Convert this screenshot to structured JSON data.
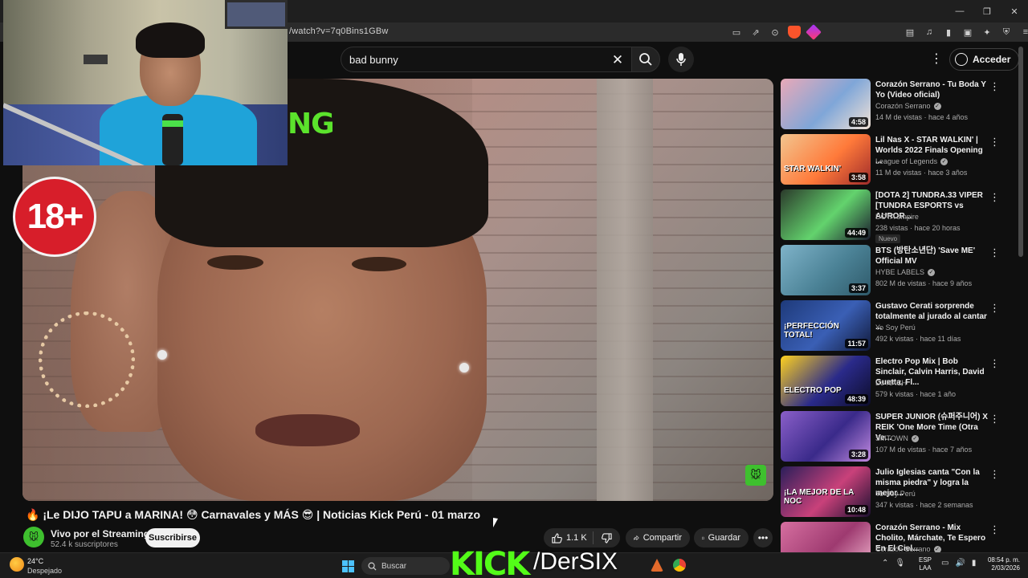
{
  "browser": {
    "url": "/watch?v=7q0Bins1GBw"
  },
  "youtube": {
    "search_query": "bad bunny",
    "signin_label": "Acceder"
  },
  "video": {
    "badge": "18+",
    "overlay_text": "NG",
    "title": "🔥 ¡Le DIJO TAPU a MARINA! 😳 Carnavales y MÁS 😎 | Noticias Kick Perú - 01 marzo",
    "channel": "Vivo por el Streaming",
    "subscribers": "52.4 k suscriptores",
    "subscribe_label": "Suscribirse",
    "likes": "1.1 K",
    "share_label": "Compartir",
    "save_label": "Guardar"
  },
  "recommendations": [
    {
      "title": "Corazón Serrano - Tu Boda Y Yo (Video oficial)",
      "channel": "Corazón Serrano",
      "verified": true,
      "meta": "14 M de vistas · hace 4 años",
      "duration": "4:58",
      "colors": [
        "#e9a9b8",
        "#7fa6d8",
        "#f2e2d6"
      ]
    },
    {
      "title": "Lil Nas X - STAR WALKIN' | Worlds 2022 Finals Opening ...",
      "channel": "League of Legends",
      "verified": true,
      "meta": "11 M de vistas · hace 3 años",
      "duration": "3:58",
      "thumb_text": "STAR WALKIN'",
      "colors": [
        "#f2c58f",
        "#ff7a3a",
        "#9e2b2b"
      ]
    },
    {
      "title": "[DOTA 2] TUNDRA.33 VIPER [TUNDRA ESPORTS vs AUROR...",
      "channel": "DOTA empire",
      "verified": false,
      "meta": "238 vistas · hace 20 horas",
      "duration": "44:49",
      "badge": "Nuevo",
      "colors": [
        "#2b3a2b",
        "#63d36d",
        "#1b1b2e"
      ]
    },
    {
      "title": "BTS (방탄소년단) 'Save ME' Official MV",
      "channel": "HYBE LABELS",
      "verified": true,
      "meta": "802 M de vistas · hace 9 años",
      "duration": "3:37",
      "colors": [
        "#7fb3c9",
        "#4b8296",
        "#2f5a6a"
      ]
    },
    {
      "title": "Gustavo Cerati sorprende totalmente al jurado al cantar ...",
      "channel": "Yo Soy Perú",
      "verified": false,
      "meta": "492 k vistas · hace 11 días",
      "duration": "11:57",
      "thumb_text": "¡PERFECCIÓN TOTAL!",
      "colors": [
        "#1e3a7a",
        "#3a5fb5",
        "#111a3a"
      ]
    },
    {
      "title": "Electro Pop Mix | Bob Sinclair, Calvin Harris, David Guetta, Fl...",
      "channel": "DJ NACH",
      "verified": false,
      "meta": "579 k vistas · hace 1 año",
      "duration": "48:39",
      "thumb_text": "ELECTRO POP",
      "colors": [
        "#ffd21f",
        "#2a2a8a",
        "#0d0d2a"
      ]
    },
    {
      "title": "SUPER JUNIOR (슈퍼주니어) X REIK 'One More Time (Otra Ve...",
      "channel": "SMTOWN",
      "verified": true,
      "meta": "107 M de vistas · hace 7 años",
      "duration": "3:28",
      "colors": [
        "#8a5fc9",
        "#3a2a8a",
        "#c28ae0"
      ]
    },
    {
      "title": "Julio Iglesias canta \"Con la misma piedra\" y logra la mejor...",
      "channel": "Yo Soy Perú",
      "verified": false,
      "meta": "347 k vistas · hace 2 semanas",
      "duration": "10:48",
      "thumb_text": "¡LA MEJOR DE LA NOC",
      "colors": [
        "#2a1e5a",
        "#c9417a",
        "#1a1030"
      ]
    },
    {
      "title": "Corazón Serrano - Mix Cholito, Márchate, Te Espero En El Ciel...",
      "channel": "Corazón Serrano",
      "verified": true,
      "meta": "",
      "duration": "",
      "colors": [
        "#d66fa0",
        "#9e3a70",
        "#f2b8d0"
      ]
    }
  ],
  "taskbar": {
    "temperature": "24°C",
    "weather": "Despejado",
    "search_label": "Buscar",
    "kick_brand": "KICK",
    "kick_handle": "/DerSIX",
    "lang_line1": "ESP",
    "lang_line2": "LAA",
    "time": "08:54 p. m.",
    "date": "2/03/2026"
  }
}
